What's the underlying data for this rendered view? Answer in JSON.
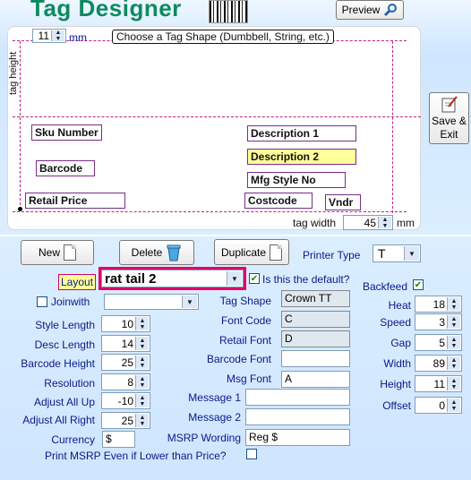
{
  "app": {
    "title": "Tag Designer"
  },
  "header": {
    "preview_label": "Preview"
  },
  "design": {
    "top_spin_value": "11",
    "top_spin_unit": "mm",
    "choose_shape_label": "Choose a Tag Shape (Dumbbell, String, etc.)",
    "tag_height_label": "tag height",
    "tag_width_label": "tag width",
    "tag_width_value": "45",
    "tag_width_unit": "mm",
    "fields": {
      "sku": "Sku Number",
      "description1": "Description 1",
      "description2": "Description 2",
      "barcode": "Barcode",
      "mfg_style": "Mfg Style No",
      "retail_price": "Retail Price",
      "costcode": "Costcode",
      "vndr": "Vndr"
    },
    "description2_color": "#ffff99"
  },
  "side": {
    "save_exit_line1": "Save &",
    "save_exit_line2": "Exit"
  },
  "toolbar": {
    "new_label": "New",
    "delete_label": "Delete",
    "duplicate_label": "Duplicate",
    "printer_type_label": "Printer Type",
    "printer_type_value": "T"
  },
  "layout": {
    "label": "Layout",
    "value": "rat tail 2",
    "default_label": "Is this the default?",
    "default_checked": true,
    "joinwith_label": "Joinwith",
    "joinwith_checked": false,
    "backfeed_label": "Backfeed",
    "backfeed_checked": true,
    "highlight_color": "#e0006a"
  },
  "form_left": [
    {
      "label": "Style Length",
      "value": "10"
    },
    {
      "label": "Desc Length",
      "value": "14"
    },
    {
      "label": "Barcode Height",
      "value": "25"
    },
    {
      "label": "Resolution",
      "value": "8"
    },
    {
      "label": "Adjust All Up",
      "value": "-10"
    },
    {
      "label": "Adjust All Right",
      "value": "25"
    }
  ],
  "currency": {
    "label": "Currency",
    "value": "$"
  },
  "print_msrp_label": "Print MSRP Even if Lower than Price?",
  "form_middle": {
    "tag_shape_label": "Tag Shape",
    "tag_shape_value": "Crown TT",
    "font_code_label": "Font Code",
    "font_code_value": "C",
    "retail_font_label": "Retail Font",
    "retail_font_value": "D",
    "barcode_font_label": "Barcode Font",
    "barcode_font_value": "",
    "msg_font_label": "Msg Font",
    "msg_font_value": "A",
    "message1_label": "Message 1",
    "message1_value": "",
    "message2_label": "Message 2",
    "message2_value": "",
    "msrp_wording_label": "MSRP Wording",
    "msrp_wording_value": "Reg $"
  },
  "form_right": [
    {
      "label": "Heat",
      "value": "18"
    },
    {
      "label": "Speed",
      "value": "3"
    },
    {
      "label": "Gap",
      "value": "5"
    },
    {
      "label": "Width",
      "value": "89"
    },
    {
      "label": "Height",
      "value": "11"
    },
    {
      "label": "Offset",
      "value": "0"
    }
  ]
}
